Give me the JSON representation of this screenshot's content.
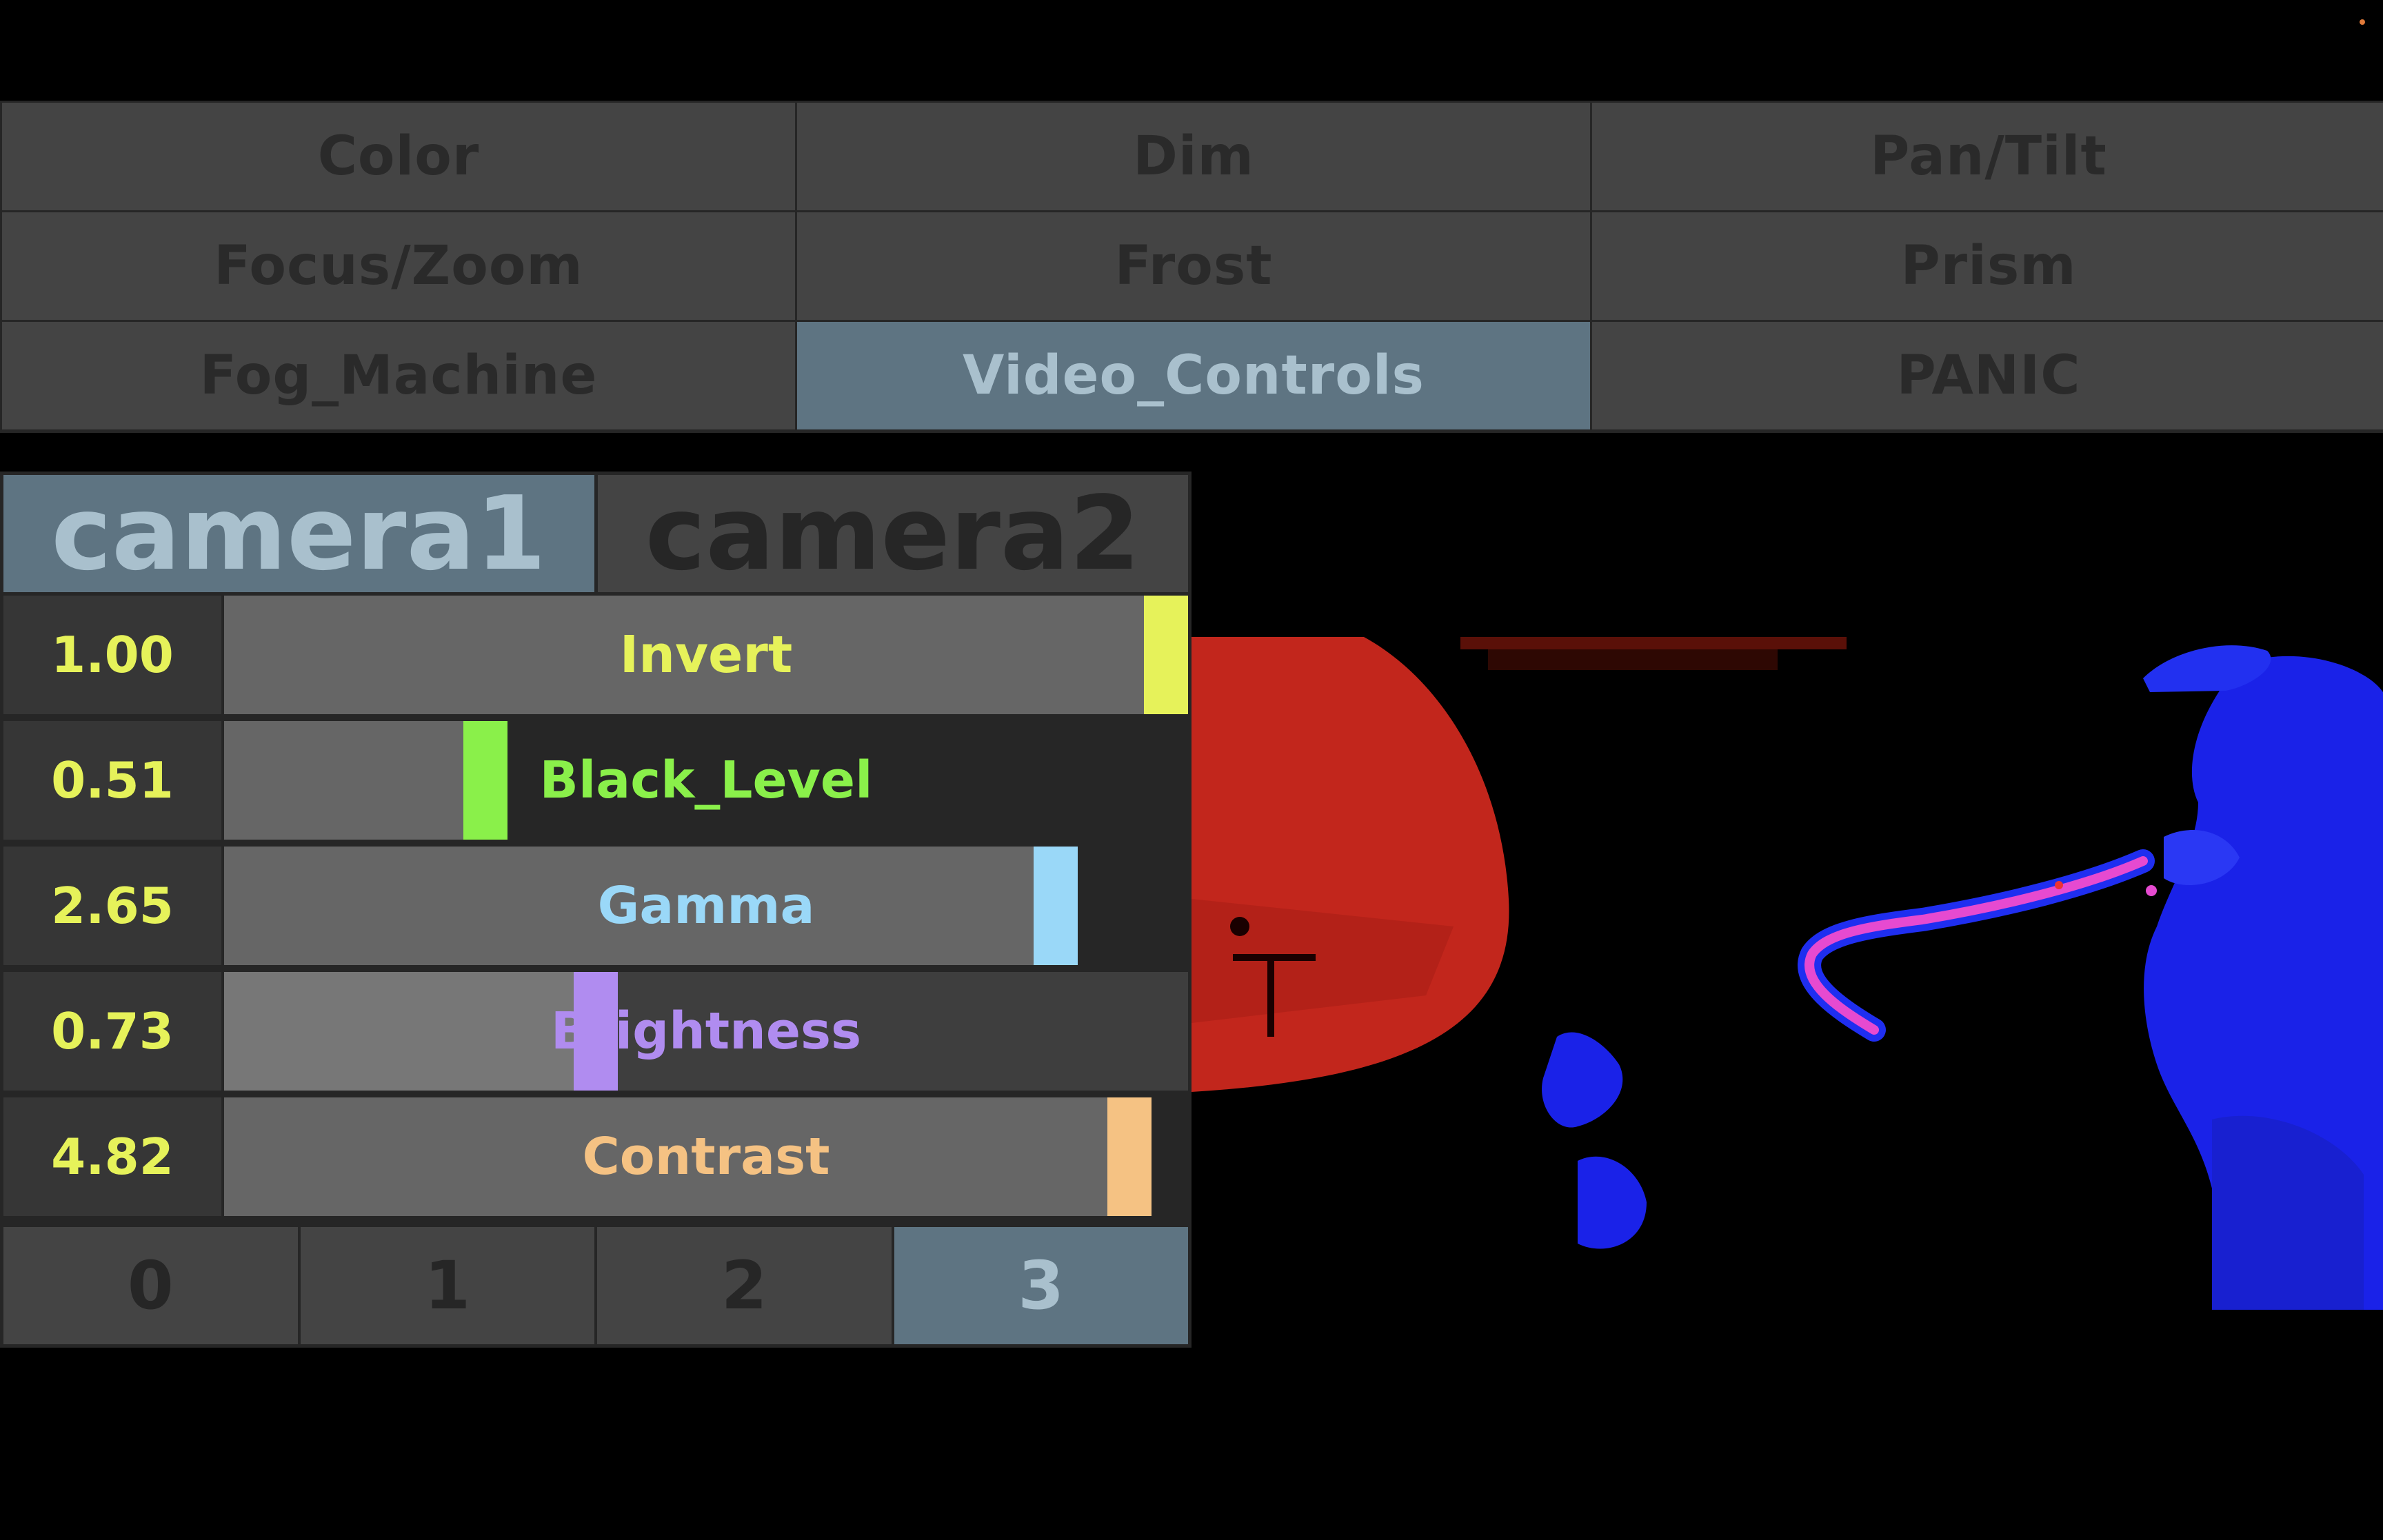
{
  "nav": {
    "buttons": [
      {
        "label": "Color",
        "active": false
      },
      {
        "label": "Dim",
        "active": false
      },
      {
        "label": "Pan/Tilt",
        "active": false
      },
      {
        "label": "Focus/Zoom",
        "active": false
      },
      {
        "label": "Frost",
        "active": false
      },
      {
        "label": "Prism",
        "active": false
      },
      {
        "label": "Fog_Machine",
        "active": false
      },
      {
        "label": "Video_Controls",
        "active": true
      },
      {
        "label": "PANIC",
        "active": false
      }
    ]
  },
  "cameras": {
    "tabs": [
      {
        "label": "camera1",
        "active": true
      },
      {
        "label": "camera2",
        "active": false
      }
    ]
  },
  "faders": [
    {
      "value_text": "1.00",
      "label": "Invert",
      "level": 1.0,
      "color": "#e6f25a"
    },
    {
      "value_text": "0.51",
      "label": "Black_Level",
      "level": 0.26,
      "color": "#8af04a"
    },
    {
      "value_text": "2.65",
      "label": "Gamma",
      "level": 0.88,
      "color": "#9ad8f8"
    },
    {
      "value_text": "0.73",
      "label": "Brightness",
      "level": 0.38,
      "color": "#b08cf0"
    },
    {
      "value_text": "4.82",
      "label": "Contrast",
      "level": 0.96,
      "color": "#f5c283"
    }
  ],
  "presets": {
    "buttons": [
      {
        "label": "0",
        "active": false
      },
      {
        "label": "1",
        "active": false
      },
      {
        "label": "2",
        "active": false
      },
      {
        "label": "3",
        "active": true
      }
    ]
  },
  "colors": {
    "active_bg": "#5e7482",
    "button_bg": "#444444",
    "value_text": "#e6f25a"
  }
}
